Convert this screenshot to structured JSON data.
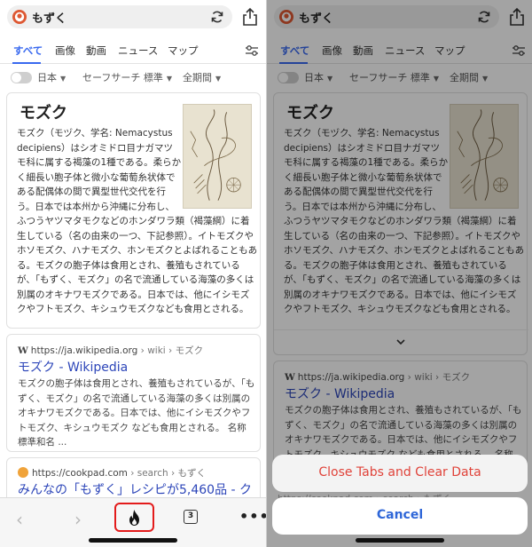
{
  "search": {
    "query": "もずく"
  },
  "tabs": [
    "すべて",
    "画像",
    "動画",
    "ニュース",
    "マップ"
  ],
  "options": {
    "region": "日本",
    "safesearch": "セーフサーチ 標準",
    "time": "全期間"
  },
  "knowledge_panel": {
    "title": "モズク",
    "text": "モズク（モヅク、学名: Nemacystus decipiens）はシオミドロ目ナガマツモ科に属する褐藻の1種である。柔らかく細長い胞子体と微小な葡萄糸状体である配偶体の間で異型世代交代を行う。日本では本州から沖縄に分布し、ふつうヤツマタモクなどのホンダワラ類（褐藻綱）に着生している（名の由来の一つ、下記参照）。イトモズクやホソモズク、ハナモズク、ホンモズクとよばれることもある。モズクの胞子体は食用とされ、養殖もされているが、「もずく、モズク」の名で流通している海藻の多くは別属のオキナワモズクである。日本では、他にイシモズクやフトモズク、キシュウモズクなども食用とされる。"
  },
  "result1": {
    "source": "https://ja.wikipedia.org",
    "path": " › wiki › モズク",
    "title": "モズク - Wikipedia",
    "snippet": "モズクの胞子体は食用とされ、養殖もされているが、「もずく、モズク」の名で流通している海藻の多くは別属のオキナワモズクである。日本では、他にイシモズクやフトモズク、キシュウモズク なども食用とされる。 名称 標準和名 ..."
  },
  "result2": {
    "source": "https://cookpad.com",
    "path": " › search › もずく",
    "title": "みんなの「もずく」レシピが5,460品 - ク"
  },
  "toolbar": {
    "tab_count": "3",
    "back": "‹",
    "forward": "›",
    "more": "•••"
  },
  "action_sheet": {
    "clear_label": "Close Tabs and Clear Data",
    "cancel_label": "Cancel"
  },
  "colors": {
    "accent": "#3969ef",
    "link": "#2d46b9",
    "destructive": "#e0433a",
    "fire_highlight": "#e31b1b"
  }
}
